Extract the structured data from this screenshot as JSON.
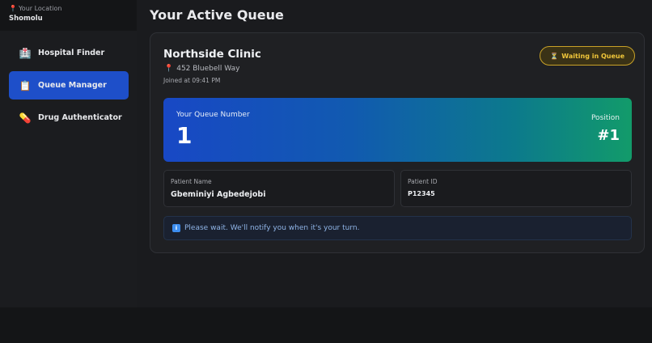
{
  "location": {
    "label": "Your Location",
    "value": "Shomolu",
    "icon": "pin-icon"
  },
  "sidebar": {
    "items": [
      {
        "label": "Hospital Finder",
        "icon": "hospital-icon",
        "active": false
      },
      {
        "label": "Queue Manager",
        "icon": "clipboard-icon",
        "active": true
      },
      {
        "label": "Drug Authenticator",
        "icon": "pill-icon",
        "active": false
      }
    ]
  },
  "page": {
    "title": "Your Active Queue"
  },
  "queue": {
    "clinic_name": "Northside Clinic",
    "address": "452 Bluebell Way",
    "joined": "Joined at 09:41 PM",
    "status": "Waiting in Queue",
    "number_label": "Your Queue Number",
    "number": "1",
    "position_label": "Position",
    "position": "#1",
    "patient_name_label": "Patient Name",
    "patient_name": "Gbeminiyi Agbedejobi",
    "patient_id_label": "Patient ID",
    "patient_id": "P12345",
    "notice": "Please wait. We'll notify you when it's your turn."
  },
  "colors": {
    "accent": "#1e4fc9",
    "badge": "#f0c63a",
    "gradient_start": "#1848c5",
    "gradient_end": "#129b6a"
  }
}
